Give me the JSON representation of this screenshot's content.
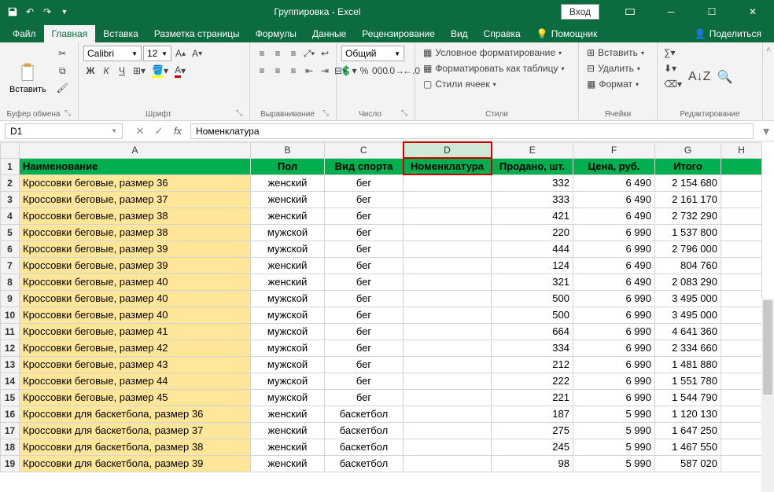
{
  "titlebar": {
    "title": "Группировка - Excel",
    "login": "Вход"
  },
  "tabs": {
    "file": "Файл",
    "home": "Главная",
    "insert": "Вставка",
    "layout": "Разметка страницы",
    "formulas": "Формулы",
    "data": "Данные",
    "review": "Рецензирование",
    "view": "Вид",
    "help": "Справка",
    "assist": "Помощник",
    "share": "Поделиться"
  },
  "ribbon": {
    "clipboard": {
      "label": "Буфер обмена",
      "paste": "Вставить"
    },
    "font": {
      "label": "Шрифт",
      "name": "Calibri",
      "size": "12"
    },
    "align": {
      "label": "Выравнивание"
    },
    "number": {
      "label": "Число",
      "format": "Общий"
    },
    "styles": {
      "label": "Стили",
      "cond": "Условное форматирование",
      "tbl": "Форматировать как таблицу",
      "cell": "Стили ячеек"
    },
    "cells": {
      "label": "Ячейки",
      "insert": "Вставить",
      "delete": "Удалить",
      "format": "Формат"
    },
    "editing": {
      "label": "Редактирование"
    }
  },
  "formula_bar": {
    "cell": "D1",
    "value": "Номенклатура"
  },
  "columns": {
    "a": "A",
    "b": "B",
    "c": "C",
    "d": "D",
    "e": "E",
    "f": "F",
    "g": "G",
    "h": "H"
  },
  "headers": {
    "name": "Наименование",
    "sex": "Пол",
    "sport": "Вид спорта",
    "nomen": "Номенклатура",
    "sold": "Продано, шт.",
    "price": "Цена, руб.",
    "total": "Итого"
  },
  "rows": [
    {
      "n": "Кроссовки беговые, размер 36",
      "s": "женский",
      "p": "бег",
      "sold": "332",
      "pr": "6 490",
      "t": "2 154 680"
    },
    {
      "n": "Кроссовки беговые, размер 37",
      "s": "женский",
      "p": "бег",
      "sold": "333",
      "pr": "6 490",
      "t": "2 161 170"
    },
    {
      "n": "Кроссовки беговые, размер 38",
      "s": "женский",
      "p": "бег",
      "sold": "421",
      "pr": "6 490",
      "t": "2 732 290"
    },
    {
      "n": "Кроссовки беговые, размер 38",
      "s": "мужской",
      "p": "бег",
      "sold": "220",
      "pr": "6 990",
      "t": "1 537 800"
    },
    {
      "n": "Кроссовки беговые, размер 39",
      "s": "мужской",
      "p": "бег",
      "sold": "444",
      "pr": "6 990",
      "t": "2 796 000"
    },
    {
      "n": "Кроссовки беговые, размер 39",
      "s": "женский",
      "p": "бег",
      "sold": "124",
      "pr": "6 490",
      "t": "804 760"
    },
    {
      "n": "Кроссовки беговые, размер 40",
      "s": "женский",
      "p": "бег",
      "sold": "321",
      "pr": "6 490",
      "t": "2 083 290"
    },
    {
      "n": "Кроссовки беговые, размер 40",
      "s": "мужской",
      "p": "бег",
      "sold": "500",
      "pr": "6 990",
      "t": "3 495 000"
    },
    {
      "n": "Кроссовки беговые, размер 40",
      "s": "мужской",
      "p": "бег",
      "sold": "500",
      "pr": "6 990",
      "t": "3 495 000"
    },
    {
      "n": "Кроссовки беговые, размер 41",
      "s": "мужской",
      "p": "бег",
      "sold": "664",
      "pr": "6 990",
      "t": "4 641 360"
    },
    {
      "n": "Кроссовки беговые, размер 42",
      "s": "мужской",
      "p": "бег",
      "sold": "334",
      "pr": "6 990",
      "t": "2 334 660"
    },
    {
      "n": "Кроссовки беговые, размер 43",
      "s": "мужской",
      "p": "бег",
      "sold": "212",
      "pr": "6 990",
      "t": "1 481 880"
    },
    {
      "n": "Кроссовки беговые, размер 44",
      "s": "мужской",
      "p": "бег",
      "sold": "222",
      "pr": "6 990",
      "t": "1 551 780"
    },
    {
      "n": "Кроссовки беговые, размер 45",
      "s": "мужской",
      "p": "бег",
      "sold": "221",
      "pr": "6 990",
      "t": "1 544 790"
    },
    {
      "n": "Кроссовки для баскетбола, размер 36",
      "s": "женский",
      "p": "баскетбол",
      "sold": "187",
      "pr": "5 990",
      "t": "1 120 130"
    },
    {
      "n": "Кроссовки для баскетбола, размер 37",
      "s": "женский",
      "p": "баскетбол",
      "sold": "275",
      "pr": "5 990",
      "t": "1 647 250"
    },
    {
      "n": "Кроссовки для баскетбола, размер 38",
      "s": "женский",
      "p": "баскетбол",
      "sold": "245",
      "pr": "5 990",
      "t": "1 467 550"
    },
    {
      "n": "Кроссовки для баскетбола, размер 39",
      "s": "женский",
      "p": "баскетбол",
      "sold": "98",
      "pr": "5 990",
      "t": "587 020"
    }
  ]
}
